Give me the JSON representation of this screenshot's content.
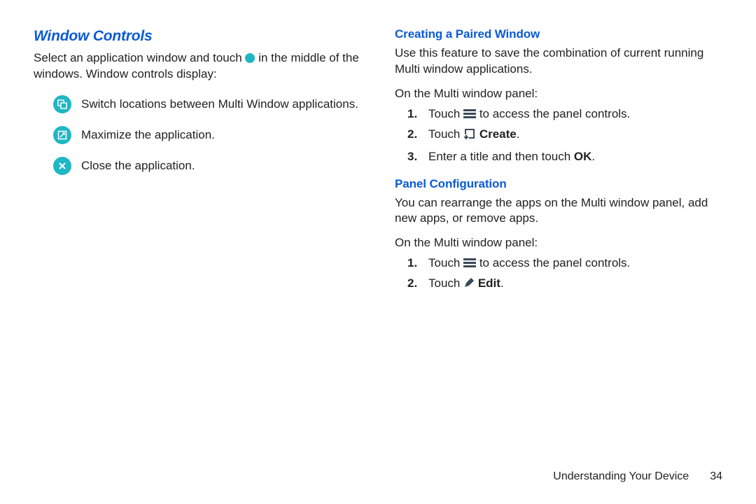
{
  "left": {
    "heading": "Window Controls",
    "intro_before": "Select an application window and touch ",
    "intro_after": " in the middle of the windows. Window controls display:",
    "controls": {
      "switch": "Switch locations between Multi Window applications.",
      "maximize": "Maximize the application.",
      "close": "Close the application."
    }
  },
  "right": {
    "creating": {
      "heading": "Creating a Paired Window",
      "desc": "Use this feature to save the combination of current running Multi window applications.",
      "prelist": "On the Multi window panel:",
      "step1_before": "Touch ",
      "step1_after": " to access the panel controls.",
      "step2_before": "Touch ",
      "step2_bold": "Create",
      "step2_after": ".",
      "step3_before": "Enter a title and then touch ",
      "step3_bold": "OK",
      "step3_after": "."
    },
    "panelcfg": {
      "heading": "Panel Configuration",
      "desc": "You can rearrange the apps on the Multi window panel, add new apps, or remove apps.",
      "prelist": "On the Multi window panel:",
      "step1_before": "Touch ",
      "step1_after": " to access the panel controls.",
      "step2_before": "Touch ",
      "step2_bold": "Edit",
      "step2_after": "."
    }
  },
  "footer": {
    "chapter": "Understanding Your Device",
    "page": "34"
  }
}
